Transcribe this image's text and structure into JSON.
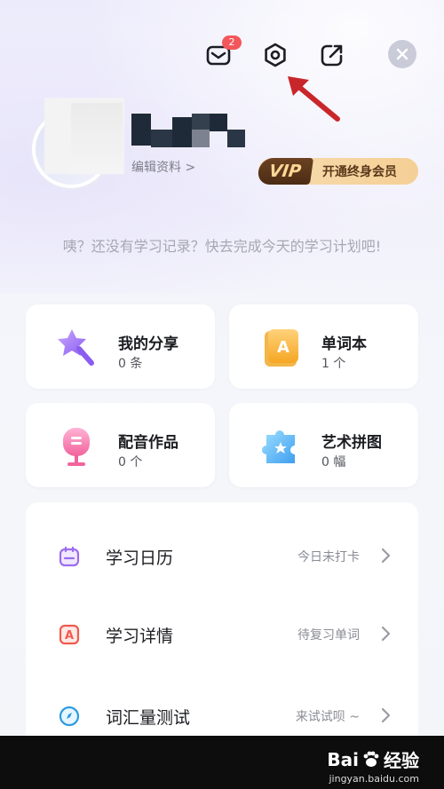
{
  "header": {
    "mail_badge": "2"
  },
  "profile": {
    "edit_label": "编辑资料 >",
    "vip_logo": "VIP",
    "vip_label": "开通终身会员"
  },
  "hint": "咦？还没有学习记录？快去完成今天的学习计划吧!",
  "cards": [
    {
      "title": "我的分享",
      "count": "0 条",
      "icon": "magic-wand-star-icon"
    },
    {
      "title": "单词本",
      "count": "1 个",
      "icon": "vocabulary-book-icon"
    },
    {
      "title": "配音作品",
      "count": "0 个",
      "icon": "microphone-icon"
    },
    {
      "title": "艺术拼图",
      "count": "0 幅",
      "icon": "puzzle-piece-icon"
    }
  ],
  "list": [
    {
      "label": "学习日历",
      "status": "今日未打卡",
      "icon": "calendar-icon"
    },
    {
      "label": "学习详情",
      "status": "待复习单词",
      "icon": "letter-a-icon"
    },
    {
      "label": "词汇量测试",
      "status": "来试试呗 ~",
      "icon": "compass-icon"
    }
  ],
  "watermark": {
    "brand": "Bai",
    "brand2": "经验",
    "url": "jingyan.baidu.com"
  },
  "colors": {
    "accent_purple": "#9b6cf0",
    "badge_red": "#f2575b",
    "arrow_red": "#c9262b",
    "vip_gold": "#f5cf95",
    "vip_brown": "#4b2c14"
  }
}
